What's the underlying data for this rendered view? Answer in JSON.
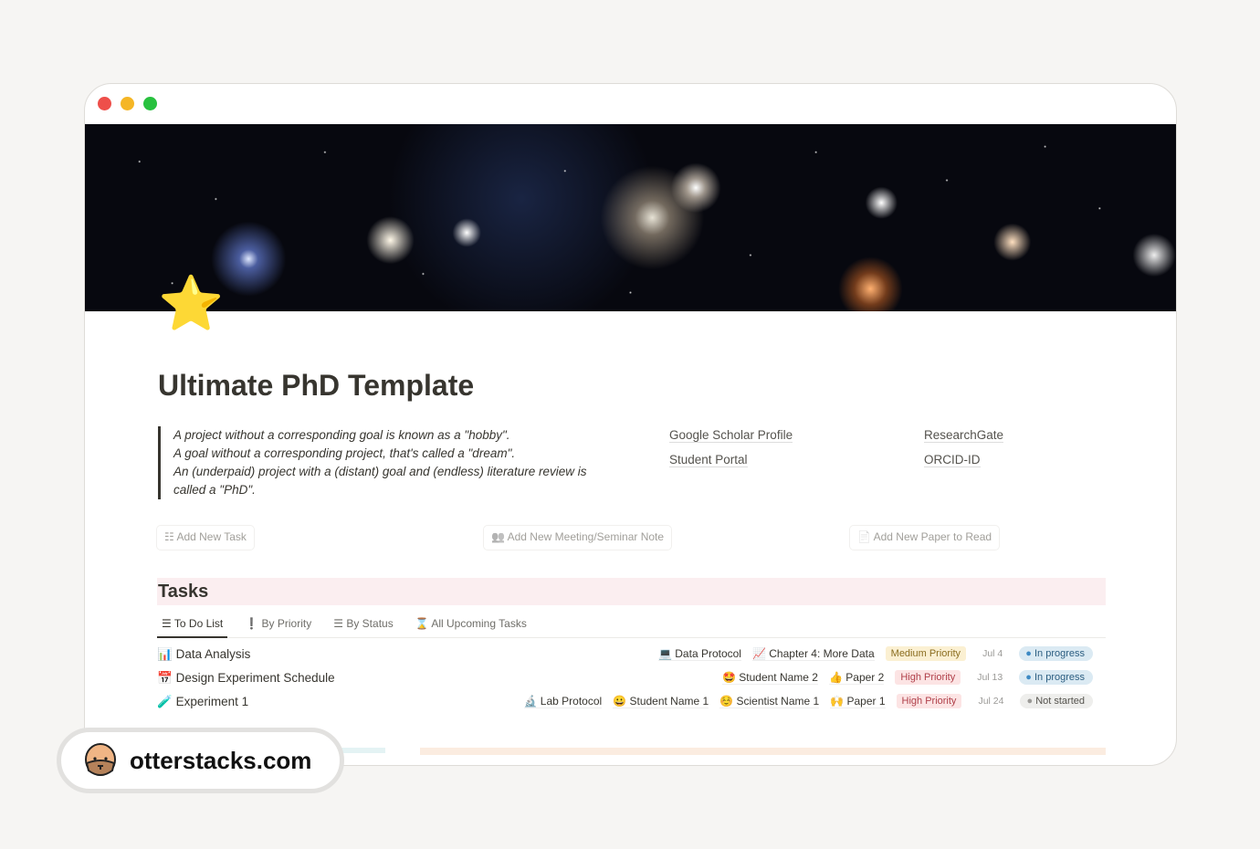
{
  "window": {
    "controls": [
      "close",
      "minimize",
      "maximize"
    ],
    "colors": {
      "close": "#ee4f4a",
      "minimize": "#f5b625",
      "maximize": "#28c13f"
    }
  },
  "page": {
    "icon": "⭐",
    "title": "Ultimate PhD Template",
    "quote": [
      "A project without a corresponding goal is known as a \"hobby\".",
      "A goal without a corresponding project, that's called a \"dream\".",
      "An (underpaid) project with a (distant) goal and (endless) literature review is called a \"PhD\"."
    ],
    "links": [
      "Google Scholar Profile",
      "ResearchGate",
      "Student Portal",
      "ORCID-ID"
    ],
    "buttons": [
      {
        "icon": "☷",
        "label": "Add New Task"
      },
      {
        "icon": "👥",
        "label": "Add New Meeting/Seminar Note"
      },
      {
        "icon": "📄",
        "label": "Add New Paper to Read"
      }
    ]
  },
  "tasks": {
    "title": "Tasks",
    "tabs": [
      {
        "icon": "☰",
        "label": "To Do List",
        "active": true
      },
      {
        "icon": "❗",
        "label": "By Priority"
      },
      {
        "icon": "☰",
        "label": "By Status"
      },
      {
        "icon": "⌛",
        "label": "All Upcoming Tasks"
      }
    ],
    "rows": [
      {
        "icon": "📊",
        "name": "Data Analysis",
        "relations": [
          {
            "icon": "💻",
            "label": "Data Protocol"
          },
          {
            "icon": "📈",
            "label": "Chapter 4: More Data"
          }
        ],
        "priority": "Medium Priority",
        "date": "Jul 4",
        "status": "In progress"
      },
      {
        "icon": "📅",
        "name": "Design Experiment Schedule",
        "relations": [
          {
            "icon": "🤩",
            "label": "Student Name 2"
          },
          {
            "icon": "👍",
            "label": "Paper 2"
          }
        ],
        "priority": "High Priority",
        "date": "Jul 13",
        "status": "In progress"
      },
      {
        "icon": "🧪",
        "name": "Experiment 1",
        "relations": [
          {
            "icon": "🔬",
            "label": "Lab Protocol"
          },
          {
            "icon": "😀",
            "label": "Student Name 1"
          },
          {
            "icon": "☺️",
            "label": "Scientist Name 1"
          },
          {
            "icon": "🙌",
            "label": "Paper 1"
          }
        ],
        "priority": "High Priority",
        "date": "Jul 24",
        "status": "Not started"
      }
    ]
  },
  "colors": {
    "medium_priority_bg": "#fbf0d2",
    "high_priority_bg": "#fce4e4",
    "in_progress_bg": "#dbeaf3",
    "not_started_bg": "#eeeeec",
    "tasks_header_bg": "#fbeef0"
  },
  "watermark": {
    "icon": "otter-face",
    "text": "otterstacks.com"
  }
}
